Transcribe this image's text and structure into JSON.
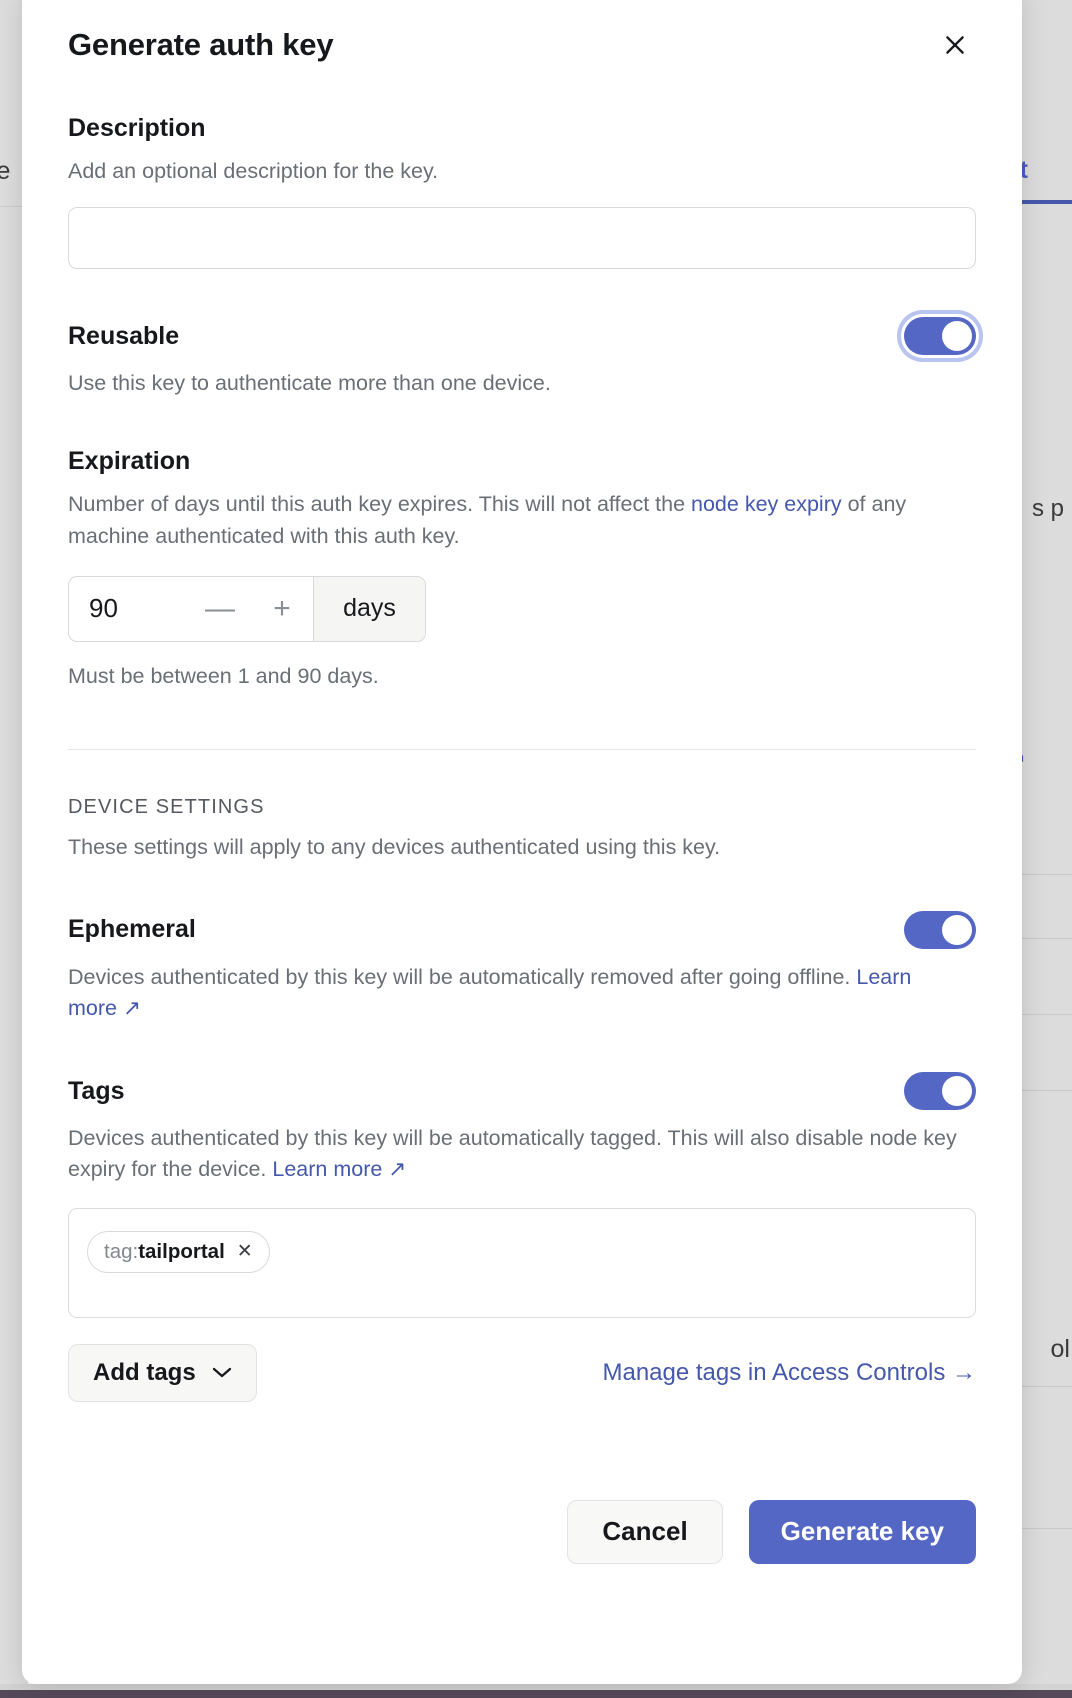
{
  "background": {
    "left_text": "ce",
    "tab_label": "et",
    "right_text": "s p",
    "right_text2": "ol",
    "link_arrow": "↗"
  },
  "modal": {
    "title": "Generate auth key",
    "close_icon": "✕",
    "description": {
      "label": "Description",
      "help": "Add an optional description for the key.",
      "value": "",
      "placeholder": ""
    },
    "reusable": {
      "label": "Reusable",
      "help": "Use this key to authenticate more than one device.",
      "enabled": true
    },
    "expiration": {
      "label": "Expiration",
      "help_before": "Number of days until this auth key expires. This will not affect the ",
      "help_link": "node key expiry",
      "help_after": " of any machine authenticated with this auth key.",
      "value": "90",
      "minus_label": "—",
      "plus_label": "+",
      "unit": "days",
      "hint": "Must be between 1 and 90 days."
    },
    "device_settings": {
      "label": "DEVICE SETTINGS",
      "help": "These settings will apply to any devices authenticated using this key.",
      "ephemeral": {
        "label": "Ephemeral",
        "help": "Devices authenticated by this key will be automatically removed after going offline. ",
        "link": "Learn more",
        "link_arrow": "↗",
        "enabled": true
      },
      "tags": {
        "label": "Tags",
        "help": "Devices authenticated by this key will be automatically tagged. This will also disable node key expiry for the device. ",
        "link": "Learn more",
        "link_arrow": "↗",
        "enabled": true,
        "chips": [
          {
            "prefix": "tag:",
            "value": "tailportal",
            "remove_icon": "✕"
          }
        ],
        "add_tags_label": "Add tags",
        "add_tags_caret": "⌄",
        "manage_link": "Manage tags in Access Controls →"
      }
    },
    "footer": {
      "cancel_label": "Cancel",
      "submit_label": "Generate key"
    }
  },
  "colors": {
    "accent": "#5467c4",
    "link": "#4558ab",
    "text": "#17181c",
    "muted": "#6a6f76"
  }
}
